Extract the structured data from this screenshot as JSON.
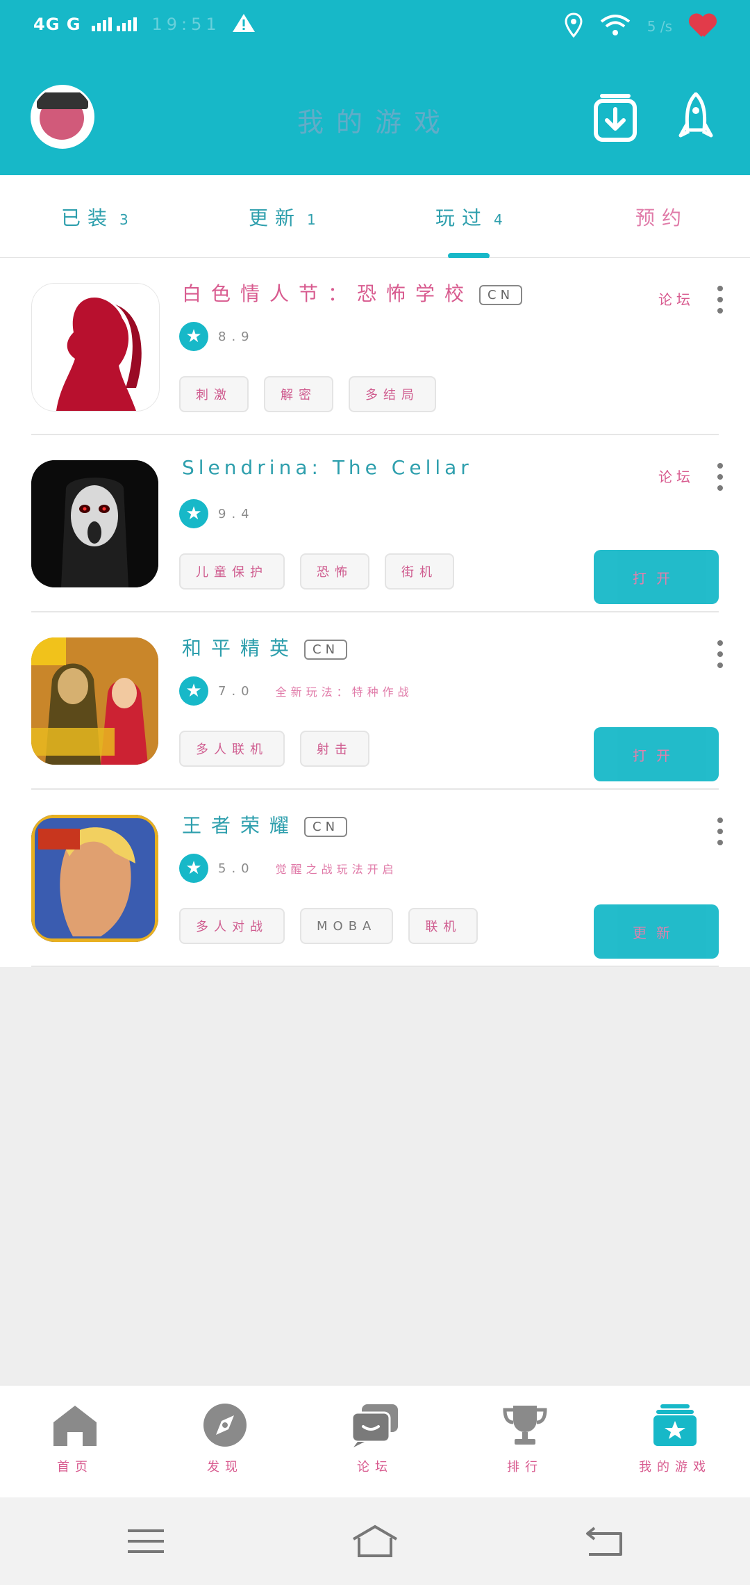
{
  "status_bar": {
    "network": "4G G",
    "time": "19:51",
    "speed": "5 /s"
  },
  "header": {
    "title": "我的游戏"
  },
  "tabs": [
    {
      "label": "已装",
      "count": "3"
    },
    {
      "label": "更新",
      "count": "1"
    },
    {
      "label": "玩过",
      "count": "4"
    },
    {
      "label": "预约",
      "count": ""
    }
  ],
  "games": [
    {
      "name": "白色情人节：恐怖学校",
      "badge": "CN",
      "rating": "8.9",
      "promo": "",
      "tags": [
        "刺激",
        "解密",
        "多结局"
      ],
      "forum": "论坛",
      "action": ""
    },
    {
      "name": "Slendrina: The Cellar",
      "badge": "",
      "rating": "9.4",
      "promo": "",
      "tags": [
        "儿童保护",
        "恐怖",
        "街机"
      ],
      "forum": "论坛",
      "action": "打开"
    },
    {
      "name": "和平精英",
      "badge": "CN",
      "rating": "7.0",
      "promo": "全新玩法：特种作战",
      "tags": [
        "多人联机",
        "射击"
      ],
      "forum": "",
      "action": "打开"
    },
    {
      "name": "王者荣耀",
      "badge": "CN",
      "rating": "5.0",
      "promo": "觉醒之战玩法开启",
      "tags": [
        "多人对战",
        "MOBA",
        "联机"
      ],
      "forum": "",
      "action": "更新"
    }
  ],
  "bottom_nav": [
    {
      "label": "首页",
      "icon": "home-icon"
    },
    {
      "label": "发现",
      "icon": "compass-icon"
    },
    {
      "label": "论坛",
      "icon": "chat-icon"
    },
    {
      "label": "排行",
      "icon": "trophy-icon"
    },
    {
      "label": "我的游戏",
      "icon": "my-games-icon"
    }
  ],
  "colors": {
    "accent": "#17b8c8",
    "pink": "#d85b8f"
  }
}
